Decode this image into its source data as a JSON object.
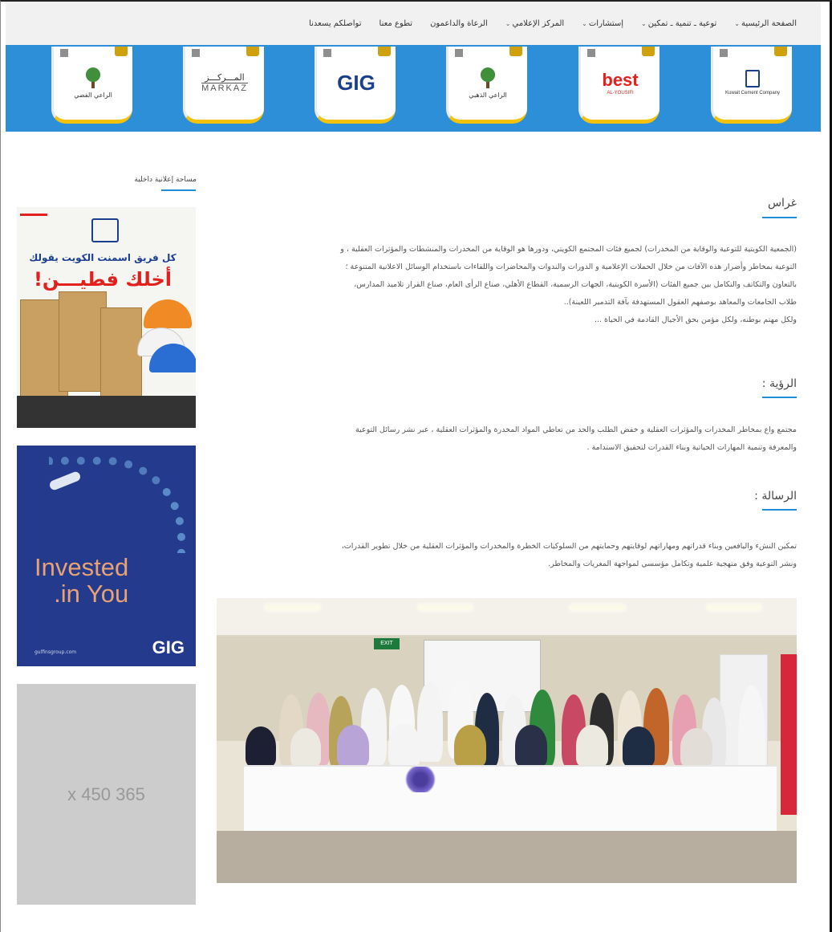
{
  "nav": {
    "items": [
      {
        "label": "الصفحة الرئيسية",
        "has_dropdown": true
      },
      {
        "label": "توعية ـ تنمية ـ تمكين",
        "has_dropdown": true
      },
      {
        "label": "إستشارات",
        "has_dropdown": true
      },
      {
        "label": "المركز الإعلامي",
        "has_dropdown": true
      },
      {
        "label": "الرعاة والداعمون",
        "has_dropdown": false
      },
      {
        "label": "تطوع معنا",
        "has_dropdown": false
      },
      {
        "label": "تواصلكم يسعدنا",
        "has_dropdown": false
      }
    ]
  },
  "sponsors": [
    {
      "name": "Kuwait Cement Company",
      "caption": "Kuwait Cement Company"
    },
    {
      "name": "best al-yousifi",
      "brand": "best",
      "caption": "AL-YOUSIFI"
    },
    {
      "name": "الراعي الذهبي",
      "caption": "الراعي الذهبي"
    },
    {
      "name": "GIG",
      "brand": "GIG"
    },
    {
      "name": "المركز MARKAZ",
      "brand": "MARKAZ",
      "arabic": "المـــركـــز"
    },
    {
      "name": "الراعي الفضي",
      "caption": "الراعي الفضي"
    }
  ],
  "sidebar": {
    "title": "مساحة إعلانية داخلية",
    "ad1": {
      "line1": "كل فريق اسمنت الكويت يقولك",
      "line2": "أخلك فطيـــن!"
    },
    "ad2": {
      "headline_1": "Invested",
      "headline_2": "in You.",
      "url": "gulfinsgroup.com",
      "brand": "GIG"
    },
    "ad3": {
      "placeholder": "365 x 450"
    }
  },
  "content": {
    "heading_1": "غراس",
    "para_1": [
      "(الجمعية الكويتية للتوعية والوقاية من المخدرات) لجميع فئات المجتمع الكويتي، ودورها هو الوقاية من المخدرات والمنشطات والمؤثرات العقلية ، و",
      "التوعية بمخاطر وأضرار هذه الآفات من خلال الحملات الإعلامية و الدورات والندوات والمحاضرات واللقاءات باستخدام الوسائل الاعلانية المتنوعة ؛",
      "بالتعاون والتكاتف والتكامل بين جميع الفئات (الأسرة الكويتية، الجهات الرسمية، القطاع الأهلي، صناع الرأى العام، صناع القرار تلاميذ المدارس،",
      "طلاب الجامعات والمعاهد بوصفهم العقول المستهدفة بآفة التدمير اللعينة)..",
      "ولكل مهتم بوطنه، ولكل مؤمن بحق الأجيال القادمة في الحياة ..."
    ],
    "heading_2": "الرؤية :",
    "para_2": [
      "مجتمع واع بمخاطر المخدرات والمؤثرات العقلية و خفض الطلب والحد من تعاطي المواد المخدرة والمؤثرات العقلية ، عبر نشر رسائل التوعية",
      "والمعرفة وتنمية المهارات الحياتية وبناء القدرات لتحقيق الاستدامة ."
    ],
    "heading_3": "الرسالة :",
    "para_3": [
      "تمكين النشء واليافعين وبناء قدراتهم ومهاراتهم لوقايتهم وحمايتهم من السلوكيات الخطرة والمخدرات والمؤثرات العقلية من خلال تطوير القدرات،",
      "ونشر التوعية وفق منهجية علمية وتكامل مؤسسي لمواجهة المغريات والمخاطر."
    ],
    "photo_exit_sign": "EXIT"
  }
}
